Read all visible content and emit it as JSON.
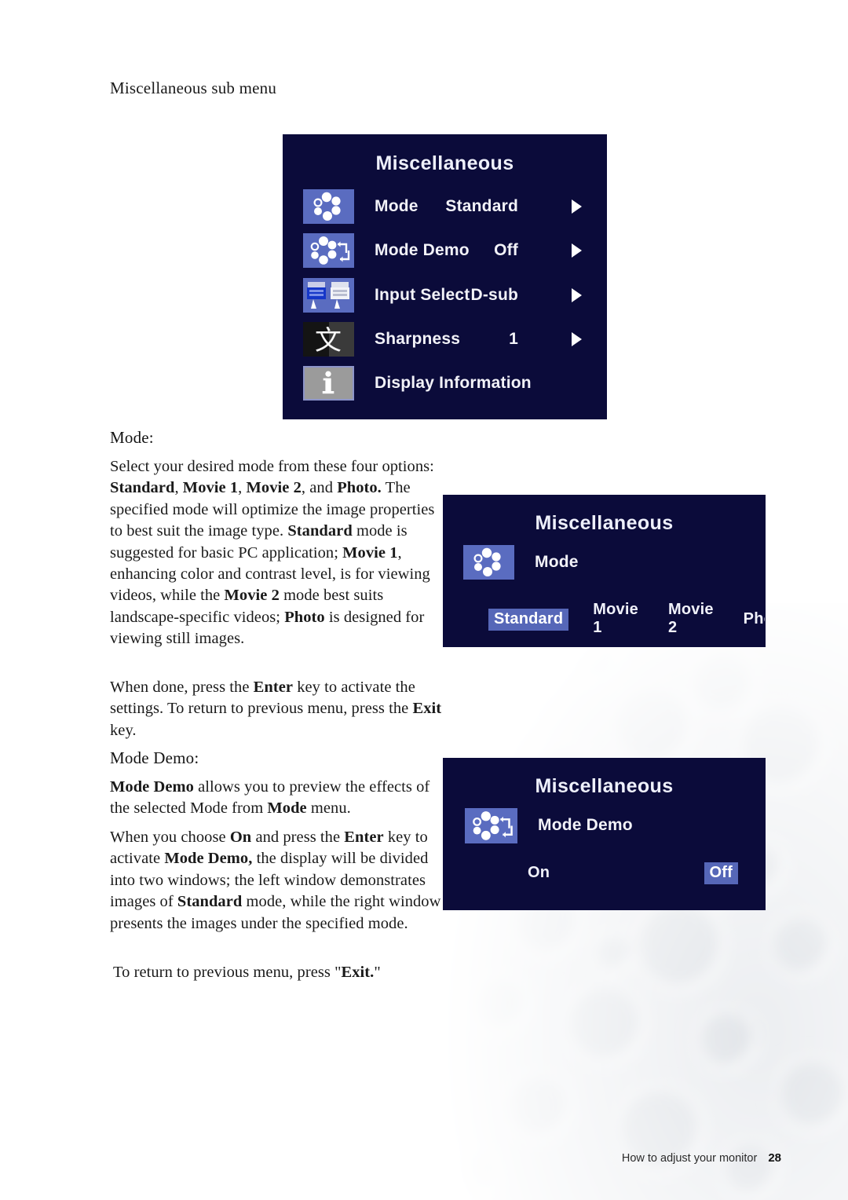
{
  "page": {
    "section_title": "Miscellaneous sub menu",
    "footer_label": "How to adjust your monitor",
    "footer_page": "28"
  },
  "osd_main": {
    "title": "Miscellaneous",
    "rows": [
      {
        "icon": "mode-dots-icon",
        "label": "Mode",
        "value": "Standard",
        "arrow": true
      },
      {
        "icon": "mode-demo-loop-icon",
        "label": "Mode Demo",
        "value": "Off",
        "arrow": true
      },
      {
        "icon": "input-select-plug-icon",
        "label": "Input Select",
        "value": "D-sub",
        "arrow": true
      },
      {
        "icon": "sharpness-glyph-icon",
        "label": "Sharpness",
        "value": "1",
        "arrow": true
      },
      {
        "icon": "display-information-icon",
        "label": "Display Information",
        "value": "",
        "arrow": false
      }
    ]
  },
  "osd_mode": {
    "title": "Miscellaneous",
    "icon": "mode-dots-icon",
    "label": "Mode",
    "options": [
      "Standard",
      "Movie 1",
      "Movie 2",
      "Photo"
    ],
    "selected": "Standard"
  },
  "osd_mode_demo": {
    "title": "Miscellaneous",
    "icon": "mode-demo-loop-icon",
    "label": "Mode Demo",
    "options": [
      "On",
      "Off"
    ],
    "selected": "Off"
  },
  "content": {
    "mode_heading": "Mode:",
    "mode_demo_heading": "Mode Demo:",
    "para_mode_1_html": "Select your desired mode from these four options: <b>Standard</b>, <b>Movie 1</b>, <b>Movie 2</b>, and <b>Photo.</b> The specified mode will optimize the image properties to best suit the image type. <b>Standard</b> mode is suggested for basic PC application; <b>Movie 1</b>, enhancing color and contrast level, is for viewing videos, while the <b>Movie 2</b> mode best suits landscape-specific videos; <b>Photo</b> is designed for viewing still images.",
    "para_mode_2_html": "When done, press the <b>Enter</b> key to activate the settings. To return to previous menu, press the <b>Exit</b> key.",
    "para_demo_1_html": "<b>Mode Demo</b> allows you to preview the effects of the selected Mode from <b>Mode</b> menu.",
    "para_demo_2_html": "When you choose <b>On</b> and press the <b>Enter</b> key to activate <b>Mode Demo,</b> the display will be divided into two windows; the left window demonstrates images of <b>Standard</b> mode, while the right window presents the images under the specified mode.",
    "para_demo_3_html": "To return to previous menu, press \"<b>Exit.</b>\""
  },
  "colors": {
    "osd_background": "#0b0b3a",
    "osd_tile": "#5a6cc0",
    "osd_highlight": "#5667b8",
    "osd_text": "#f2f2f8",
    "page_background": "#ffffff"
  }
}
